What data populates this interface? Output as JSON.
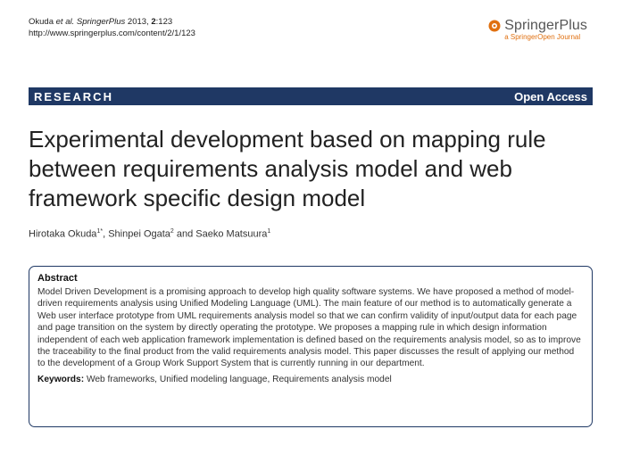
{
  "header": {
    "citation_authors": "Okuda",
    "citation_etal": "et al.",
    "citation_journal": "SpringerPlus",
    "citation_year": "2013,",
    "citation_volume": "2",
    "citation_page": ":123",
    "url": "http://www.springerplus.com/content/2/1/123"
  },
  "brand": {
    "name": "SpringerPlus",
    "subtitle": "a SpringerOpen Journal",
    "accent_color": "#e07010"
  },
  "banner": {
    "left": "RESEARCH",
    "right": "Open Access",
    "color": "#1f3864"
  },
  "article": {
    "title": "Experimental development based on mapping rule between requirements analysis model and web framework specific design model",
    "authors": [
      {
        "name": "Hirotaka Okuda",
        "affil": "1*"
      },
      {
        "name": "Shinpei Ogata",
        "affil": "2"
      },
      {
        "name": "Saeko Matsuura",
        "affil": "1"
      }
    ],
    "sep_comma": ", ",
    "sep_and": " and "
  },
  "abstract": {
    "heading": "Abstract",
    "body": "Model Driven Development is a promising approach to develop high quality software systems. We have proposed a method of model-driven requirements analysis using Unified Modeling Language (UML). The main feature of our method is to automatically generate a Web user interface prototype from UML requirements analysis model so that we can confirm validity of input/output data for each page and page transition on the system by directly operating the prototype. We proposes a mapping rule in which design information independent of each web application framework implementation is defined based on the requirements analysis model, so as to improve the traceability to the final product from the valid requirements analysis model. This paper discusses the result of applying our method to the development of a Group Work Support System that is currently running in our department.",
    "keywords_label": "Keywords:",
    "keywords": "Web frameworks, Unified modeling language, Requirements analysis model"
  }
}
